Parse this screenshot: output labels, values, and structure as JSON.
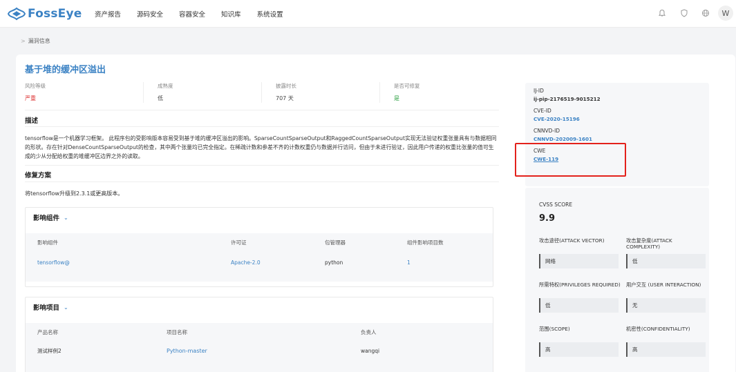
{
  "app": {
    "name": "FossEye",
    "brand_color": "#3b82c4"
  },
  "nav": [
    "资产报告",
    "源码安全",
    "容器安全",
    "知识库",
    "系统设置"
  ],
  "header_icons": [
    "bell-icon",
    "shield-icon",
    "globe-icon"
  ],
  "user": {
    "initial": "W"
  },
  "breadcrumb": {
    "separator": ">",
    "current": "漏洞信息"
  },
  "vuln": {
    "title": "基于堆的缓冲区溢出",
    "metrics": [
      {
        "label": "风险等级",
        "value": "严重",
        "color": "#dd3333"
      },
      {
        "label": "成熟度",
        "value": "低",
        "color": "#444444"
      },
      {
        "label": "披露时长",
        "value": "707 天",
        "color": "#444444"
      },
      {
        "label": "是否可修复",
        "value": "是",
        "color": "#2ea043"
      }
    ],
    "desc_title": "描述",
    "desc": "tensorflow是一个机器学习框架。 此程序包的受影响版本容易受到基于堆的缓冲区溢出的影响。SparseCountSparseOutput和RaggedCountSparseOutput实现无法验证权重张量具有与数据相同的形状。存在针对DenseCountSparseOutput的检查，其中两个张量均已完全指定。在稀疏计数和参差不齐的计数权重仍与数据并行访问，但由于未进行验证，因此用户传递的权重比张量的值可生成的少从分配给权重的堆缓冲区边界之外的读取。",
    "fix_title": "修复方案",
    "fix": "将tensorflow升级到2.3.1或更高版本。"
  },
  "components": {
    "title": "影响组件",
    "headers": [
      "影响组件",
      "许可证",
      "包管理器",
      "组件影响项目数"
    ],
    "rows": [
      {
        "name": "tensorflow@",
        "license": "Apache-2.0",
        "manager": "python",
        "count": "1"
      }
    ]
  },
  "projects": {
    "title": "影响项目",
    "headers": [
      "产品名称",
      "项目名称",
      "负责人"
    ],
    "rows": [
      {
        "product": "测试样例2",
        "project": "Python-master",
        "owner": "wangqi"
      }
    ]
  },
  "ids": [
    {
      "label": "IJ-ID",
      "value": "ij-pip-2176519-9015212",
      "link": false
    },
    {
      "label": "CVE-ID",
      "value": "CVE-2020-15196",
      "link": true
    },
    {
      "label": "CNNVD-ID",
      "value": "CNNVD-202009-1601",
      "link": true
    },
    {
      "label": "CWE",
      "value": "CWE-119",
      "link": true
    }
  ],
  "cvss": {
    "label": "CVSS SCORE",
    "score": "9.9",
    "items": [
      {
        "name": "攻击途径(ATTACK VECTOR)",
        "value": "网络"
      },
      {
        "name": "攻击复杂度(ATTACK COMPLEXITY)",
        "value": "低"
      },
      {
        "name": "所需特权(PRIVILEGES REQUIRED)",
        "value": "低"
      },
      {
        "name": "用户交互 (USER INTERACTION)",
        "value": "无"
      },
      {
        "name": "范围(SCOPE)",
        "value": "高"
      },
      {
        "name": "机密性(CONFIDENTIALITY)",
        "value": "高"
      }
    ]
  }
}
